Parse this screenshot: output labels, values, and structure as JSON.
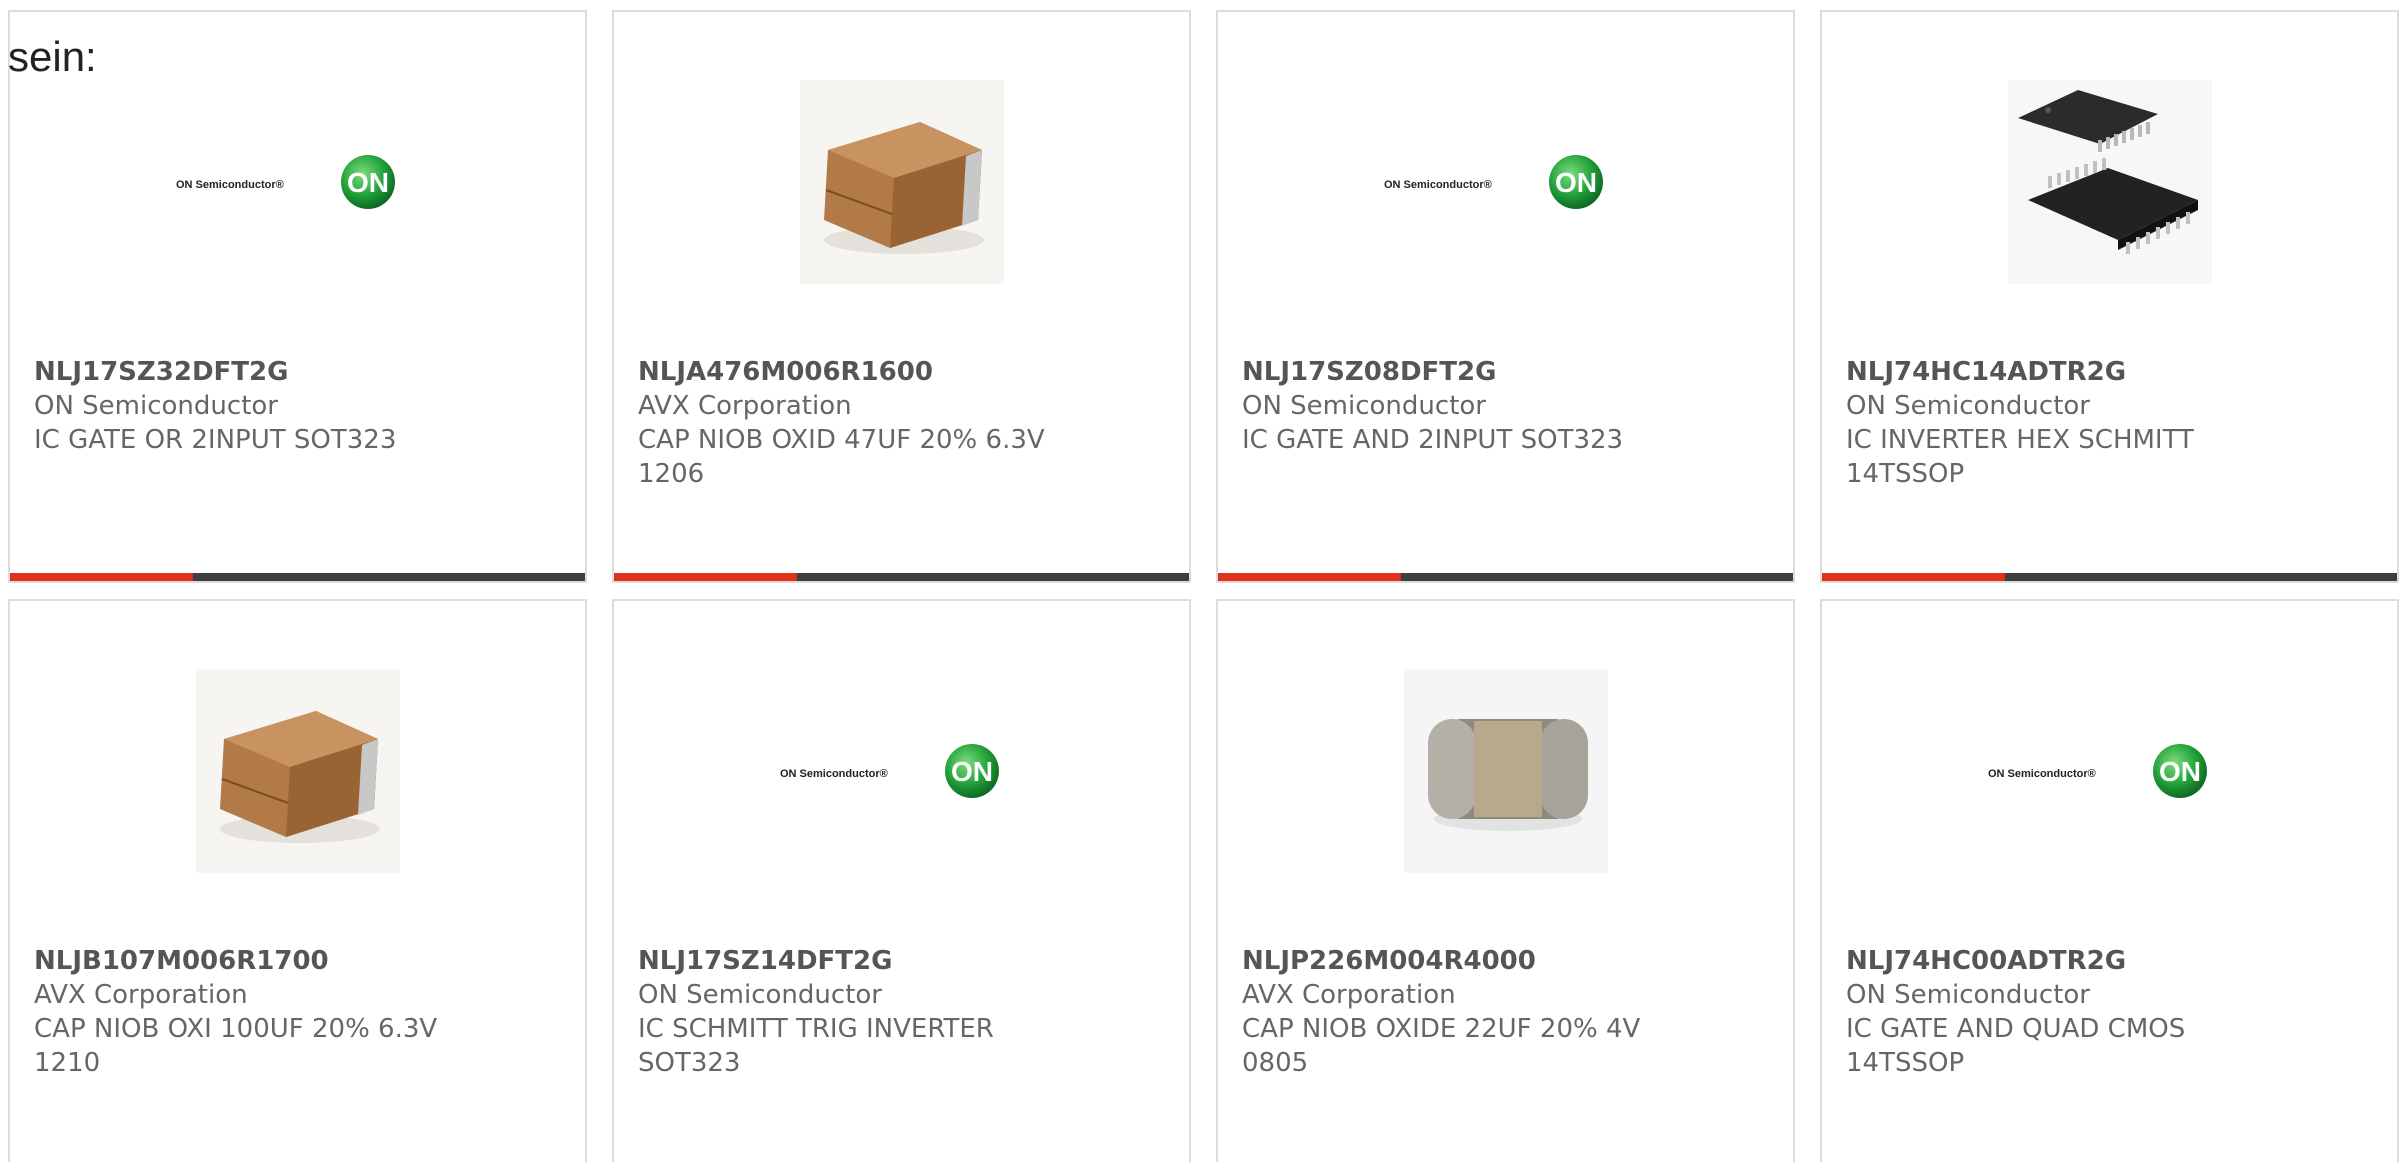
{
  "intro_text": "sein:",
  "colors": {
    "accent": "#e0321a",
    "bar_dark": "#3f3f3f",
    "text": "#666666",
    "on_green": "#22a23a"
  },
  "products": [
    {
      "part_number": "NLJ17SZ32DFT2G",
      "manufacturer": "ON Semiconductor",
      "description": "IC GATE OR 2INPUT SOT323",
      "image": "on-semiconductor-logo",
      "logo_text": "ON Semiconductor®",
      "badge_text": "ON"
    },
    {
      "part_number": "NLJA476M006R1600",
      "manufacturer": "AVX Corporation",
      "description": "CAP NIOB OXID 47UF 20% 6.3V 1206",
      "image": "tantalum-capacitor-photo"
    },
    {
      "part_number": "NLJ17SZ08DFT2G",
      "manufacturer": "ON Semiconductor",
      "description": "IC GATE AND 2INPUT SOT323",
      "image": "on-semiconductor-logo",
      "logo_text": "ON Semiconductor®",
      "badge_text": "ON"
    },
    {
      "part_number": "NLJ74HC14ADTR2G",
      "manufacturer": "ON Semiconductor",
      "description": "IC INVERTER HEX SCHMITT 14TSSOP",
      "image": "tssop-ic-photo"
    },
    {
      "part_number": "NLJB107M006R1700",
      "manufacturer": "AVX Corporation",
      "description": "CAP NIOB OXI 100UF 20% 6.3V 1210",
      "image": "tantalum-capacitor-photo"
    },
    {
      "part_number": "NLJ17SZ14DFT2G",
      "manufacturer": "ON Semiconductor",
      "description": "IC SCHMITT TRIG INVERTER SOT323",
      "image": "on-semiconductor-logo",
      "logo_text": "ON Semiconductor®",
      "badge_text": "ON"
    },
    {
      "part_number": "NLJP226M004R4000",
      "manufacturer": "AVX Corporation",
      "description": "CAP NIOB OXIDE 22UF 20% 4V 0805",
      "image": "ceramic-chip-capacitor-photo"
    },
    {
      "part_number": "NLJ74HC00ADTR2G",
      "manufacturer": "ON Semiconductor",
      "description": "IC GATE AND QUAD CMOS 14TSSOP",
      "image": "on-semiconductor-logo",
      "logo_text": "ON Semiconductor®",
      "badge_text": "ON"
    }
  ]
}
